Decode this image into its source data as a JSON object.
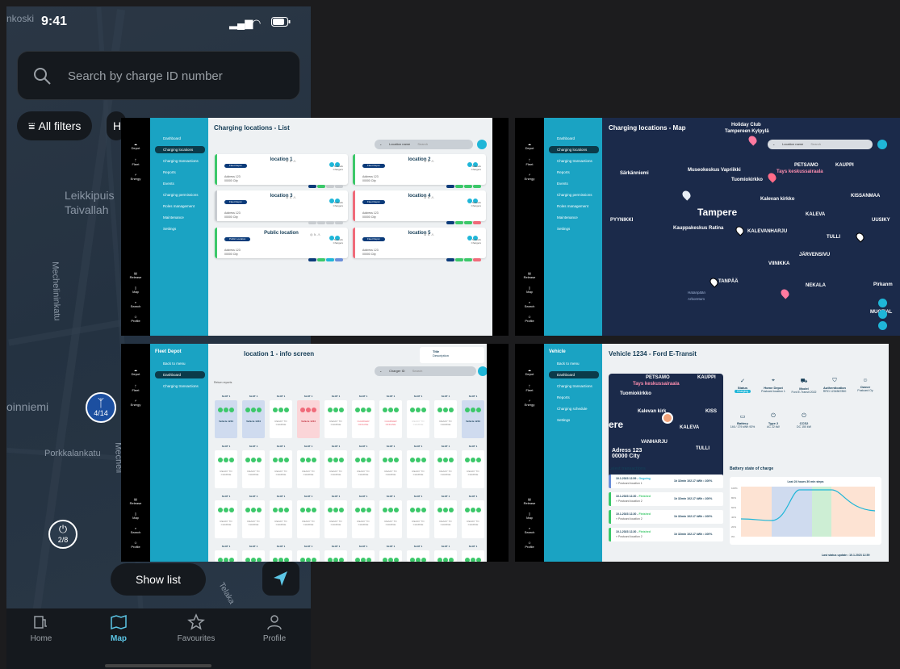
{
  "phone": {
    "status_time": "9:41",
    "search_placeholder": "Search by charge ID number",
    "filters_label": "All filters",
    "chip2_label": "H",
    "map_labels": {
      "top": "nkoski",
      "leikkipuisto": "Leikkipuis",
      "taivallahti": "Taivallah",
      "mechelininkatu": "Mechelininkatu",
      "rinniemi": "oinniemi",
      "porkkalankatu": "Porkkalankatu",
      "mecheli2": "Mecheli",
      "tela": "Telaka"
    },
    "pins": [
      {
        "label": "4/14",
        "color": "#1c4fa0"
      },
      {
        "label": "2/8",
        "color": "#2b3b4c"
      }
    ],
    "show_list_label": "Show list",
    "tabs": [
      {
        "label": "Home",
        "icon": "home-ev-icon",
        "active": false
      },
      {
        "label": "Map",
        "icon": "map-icon",
        "active": true
      },
      {
        "label": "Favourites",
        "icon": "star-icon",
        "active": false
      },
      {
        "label": "Profile",
        "icon": "profile-icon",
        "active": false
      }
    ]
  },
  "nav_rail": {
    "items": [
      "Depot",
      "Fleet",
      "Energy"
    ],
    "bottom_items": [
      "Release",
      "Map",
      "Search",
      "Profile"
    ]
  },
  "list_panel": {
    "title": "Charging locations - List",
    "search_label": "Location name",
    "search_placeholder": "Search",
    "sidebar": [
      "Dashboard",
      "Charging locations",
      "Charging transactions",
      "Reports",
      "Events",
      "Charging permissions",
      "Roles management",
      "Maintenance",
      "Settings"
    ],
    "cards": [
      {
        "name": "location 1",
        "tag": "Fleet Depot",
        "address_line1": "Address 123",
        "address_line2": "00000 City",
        "bar": "#3cc86a",
        "meta1": "Network",
        "meta2": "Chargers"
      },
      {
        "name": "location 2",
        "tag": "Fleet Depot",
        "address_line1": "Address 123",
        "address_line2": "00000 City",
        "bar": "#3cc86a",
        "meta1": "Network",
        "meta2": "Chargers"
      },
      {
        "name": "location 3",
        "tag": "Fleet Depot",
        "address_line1": "Address 123",
        "address_line2": "00000 City",
        "bar": "#c8ccd0",
        "meta1": "Network",
        "meta2": "Chargers"
      },
      {
        "name": "location 4",
        "tag": "Fleet Depot",
        "address_line1": "Address 123",
        "address_line2": "00000 City",
        "bar": "#f06b7a",
        "meta1": "Network",
        "meta2": "Chargers"
      },
      {
        "name": "Public location",
        "tag": "Public Location",
        "address_line1": "Address 123",
        "address_line2": "00000 City",
        "bar": "#3cc86a",
        "meta1": "Network",
        "meta2": "Chargers"
      },
      {
        "name": "location 5",
        "tag": "Fleet Depot",
        "address_line1": "Address 123",
        "address_line2": "00000 City",
        "bar": "#f06b7a",
        "meta1": "Network",
        "meta2": "Chargers"
      }
    ]
  },
  "map_panel": {
    "title": "Charging locations - Map",
    "search_label": "Location name",
    "search_placeholder": "Search",
    "labels": {
      "holiday": "Holiday Club",
      "holiday2": "Tampereen Kylpylä",
      "sarkanniemi": "Särkänniemi",
      "museo": "Museokeskus Vapriikki",
      "tays": "Tays keskussairaala",
      "petsamo": "PETSAMO",
      "kauppi": "KAUPPI",
      "tuomikirkko": "Tuomiokirkko",
      "kalevan": "Kalevan kirkko",
      "kissanmaa": "KISSANMAA",
      "pyynikki": "PYYNIKKI",
      "tampere": "Tampere",
      "kaleva": "KALEVA",
      "uusikyla": "UUSIKY",
      "kauppakeskus": "Kauppakeskus Ratina",
      "kalevanharju": "KALEVANHARJU",
      "tulli": "TULLI",
      "jarvensivu": "JÄRVENSIVU",
      "viinikka": "VIINIKKA",
      "rantaperkio": "TANPÄÄ",
      "nekala": "NEKALA",
      "hatanpaan": "Hatanpään",
      "arboretum": "Arboretum",
      "pirkanmaa": "Pirkanm",
      "muotiala": "MUOTIAL"
    }
  },
  "info_panel": {
    "sidebar_title": "Fleet Depot",
    "back_label": "Back to menu",
    "sidebar": [
      "Dashboard",
      "Charging transactions"
    ],
    "title": "location 1 - info screen",
    "search_label": "Charger ID",
    "search_placeholder": "Search",
    "tooltip_title": "Title",
    "tooltip_desc": "Description",
    "breadcrumb": "Return reports",
    "slot_label": "SLOT 1",
    "ready_text": "READY TO CHARGE",
    "vehicle_text": "Vehicle 1234",
    "charging_text": "CHARGER OFFLINE"
  },
  "vehicle_panel": {
    "sidebar_title": "Vehicle",
    "back_label": "Back to menu",
    "sidebar": [
      "Dashboard",
      "Charging transactions",
      "Reports",
      "Charging schedule",
      "Settings"
    ],
    "title": "Vehicle 1234 - Ford E-Transit",
    "map_address1": "Adress 123",
    "map_address2": "00000 City",
    "map_labels": {
      "petsamo": "PETSAMO",
      "kauppi": "KAUPPI",
      "tays": "Tays keskussairaala",
      "tuomikirkko": "Tuomiokirkko",
      "kalevan": "Kalevan kirk",
      "kaleva": "KALEVA",
      "kalevanharju": "VANHARJU",
      "tulli": "TULLI",
      "kiss": "KISS",
      "ere": "ere"
    },
    "info": [
      {
        "label": "Status",
        "value": "Charging"
      },
      {
        "label": "Home Depot",
        "value": "Postcard location 1"
      },
      {
        "label": "Model",
        "value": "Ford E-Transit 2022"
      },
      {
        "label": "Authentication",
        "value": "RFID 1234567890"
      },
      {
        "label": "Owner",
        "value": "Postcard Oy"
      }
    ],
    "info2": [
      {
        "label": "Battery",
        "value": "146 / 179 kWh 93%"
      },
      {
        "label": "Type 2",
        "value": "AC 22 kW"
      },
      {
        "label": "CCS2",
        "value": "DC 150 kW"
      }
    ],
    "transactions_title": "Latest transactions",
    "transactions": [
      {
        "date": "10.1.2023 12.59",
        "status": "Ongoing",
        "loc": "Postcard location 1",
        "dur": "1h 32min",
        "kwh": "102.17 kWh • 100%"
      },
      {
        "date": "10.1.2023 12.30",
        "status": "Finished",
        "loc": "Postcard location 2",
        "dur": "1h 32min",
        "kwh": "102.17 kWh • 100%"
      },
      {
        "date": "10.1.2023 12.30",
        "status": "Finished",
        "loc": "Postcard location 2",
        "dur": "1h 32min",
        "kwh": "102.17 kWh • 100%"
      },
      {
        "date": "10.1.2023 12.30",
        "status": "Finished",
        "loc": "Postcard location 2",
        "dur": "1h 32min",
        "kwh": "102.17 kWh • 100%"
      }
    ],
    "chart_title": "Battery state of charge",
    "chart_subtitle": "Last 24 hours 30 min steps",
    "chart_yticks": [
      "100%",
      "80%",
      "60%",
      "40%",
      "20%",
      "0%"
    ],
    "footer": "Last status update • 10.1.2023 12.59"
  },
  "colors": {
    "accent": "#1fb6d8",
    "sidebar": "#1aa3c3",
    "navy": "#143c55",
    "green": "#3cc86a",
    "red": "#f06b7a"
  }
}
